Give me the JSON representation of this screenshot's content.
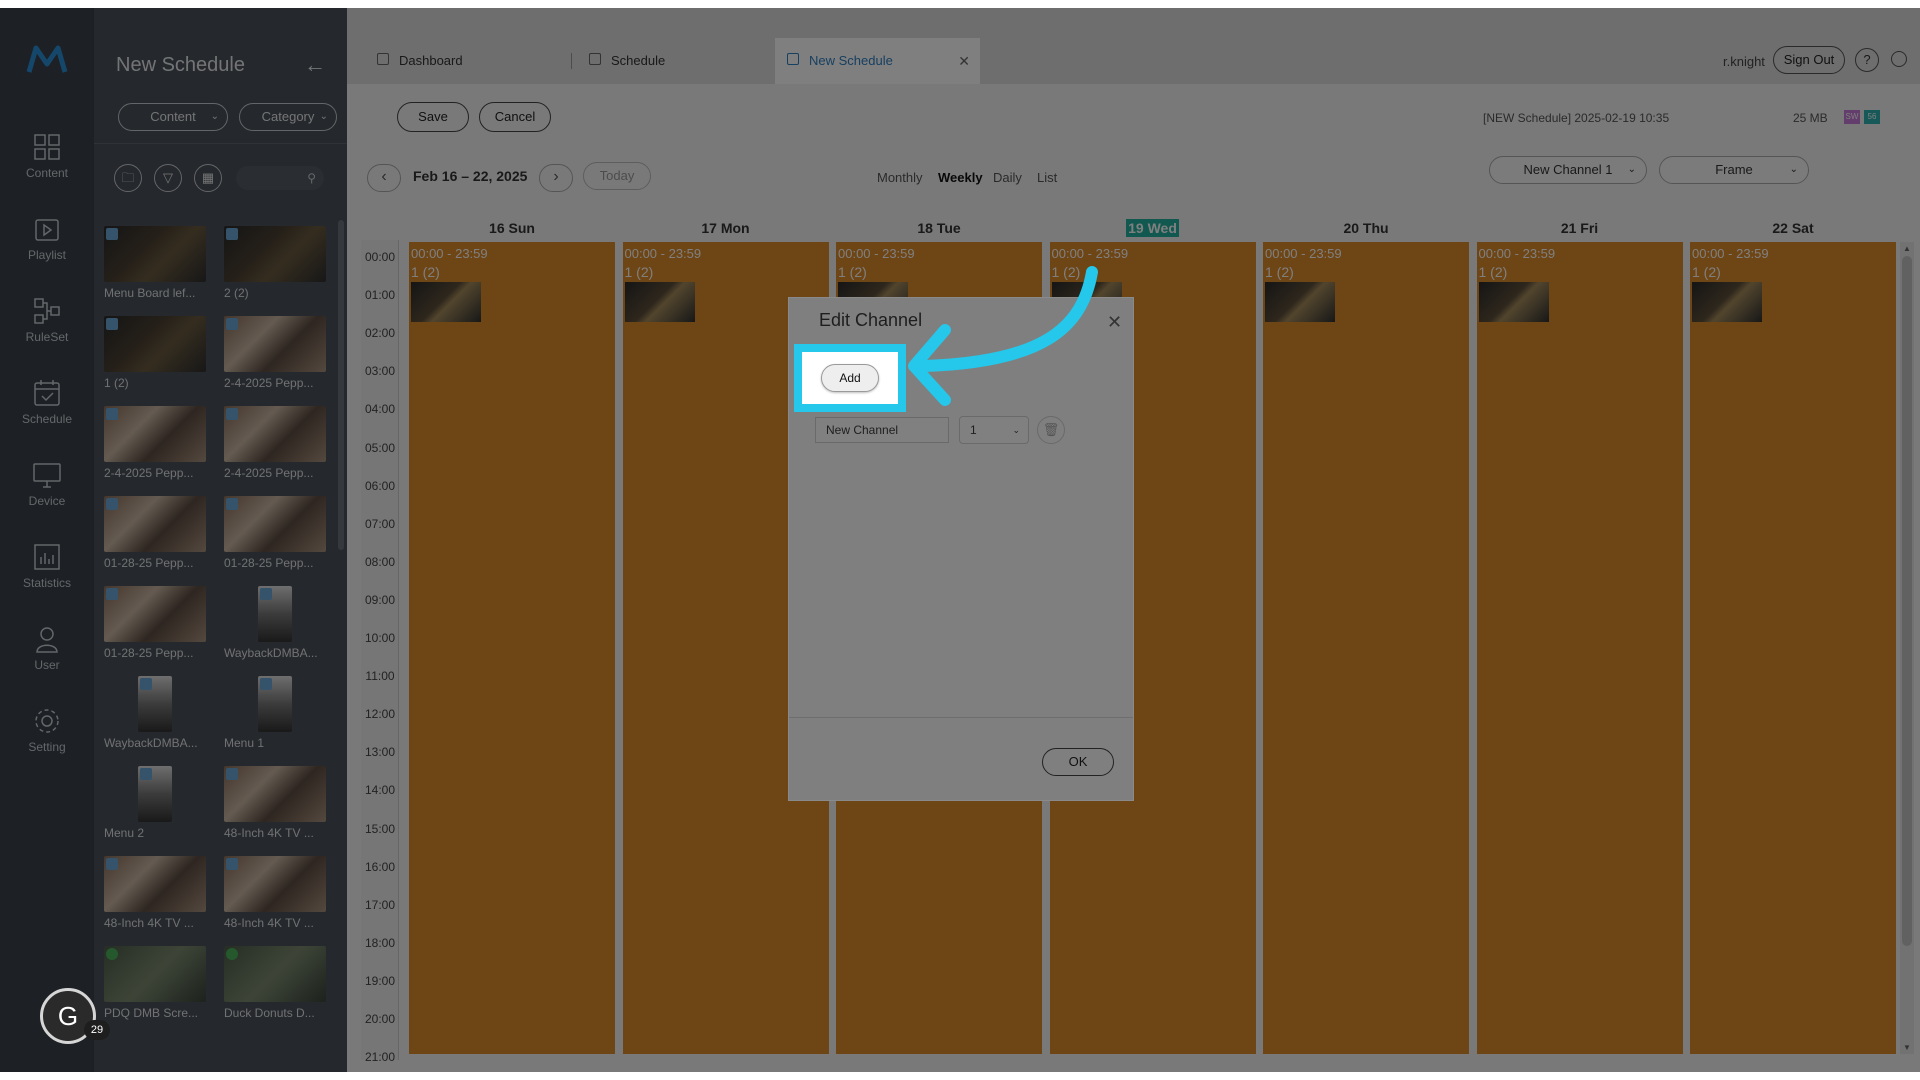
{
  "nav": {
    "items": [
      {
        "label": "Content",
        "icon": "grid-icon"
      },
      {
        "label": "Playlist",
        "icon": "playlist-icon"
      },
      {
        "label": "RuleSet",
        "icon": "ruleset-icon"
      },
      {
        "label": "Schedule",
        "icon": "calendar-icon"
      },
      {
        "label": "Device",
        "icon": "monitor-icon"
      },
      {
        "label": "Statistics",
        "icon": "bar-chart-icon"
      },
      {
        "label": "User",
        "icon": "user-icon"
      },
      {
        "label": "Setting",
        "icon": "gear-icon"
      }
    ]
  },
  "panel": {
    "title": "New Schedule",
    "filter_content": "Content",
    "filter_category": "Category",
    "thumbs": [
      {
        "caption": "Menu Board lef...",
        "kind": "menu"
      },
      {
        "caption": "2 (2)",
        "kind": "menu"
      },
      {
        "caption": "1 (2)",
        "kind": "menu"
      },
      {
        "caption": "2-4-2025 Pepp...",
        "kind": "food"
      },
      {
        "caption": "2-4-2025 Pepp...",
        "kind": "food"
      },
      {
        "caption": "2-4-2025 Pepp...",
        "kind": "food"
      },
      {
        "caption": "01-28-25 Pepp...",
        "kind": "food"
      },
      {
        "caption": "01-28-25 Pepp...",
        "kind": "food"
      },
      {
        "caption": "01-28-25 Pepp...",
        "kind": "food"
      },
      {
        "caption": "WaybackDMBA...",
        "kind": "tall"
      },
      {
        "caption": "WaybackDMBA...",
        "kind": "tall"
      },
      {
        "caption": "Menu 1",
        "kind": "tall"
      },
      {
        "caption": "Menu 2",
        "kind": "tall"
      },
      {
        "caption": "48-Inch 4K TV ...",
        "kind": "food"
      },
      {
        "caption": "48-Inch 4K TV ...",
        "kind": "food"
      },
      {
        "caption": "48-Inch 4K TV ...",
        "kind": "food"
      },
      {
        "caption": "PDQ DMB Scre...",
        "kind": "video"
      },
      {
        "caption": "Duck Donuts D...",
        "kind": "video"
      }
    ]
  },
  "tabs": [
    {
      "label": "Dashboard"
    },
    {
      "label": "Schedule"
    },
    {
      "label": "New Schedule"
    }
  ],
  "header": {
    "username": "r.knight",
    "sign_out": "Sign Out",
    "help": "?"
  },
  "toolbar": {
    "save": "Save",
    "cancel": "Cancel",
    "info": "[NEW Schedule] 2025-02-19 10:35",
    "size": "25 MB",
    "chip1": "SW",
    "chip1_color": "#c77bd8",
    "chip2": "56",
    "chip2_color": "#2fb2b0"
  },
  "calendar": {
    "range": "Feb 16 – 22, 2025",
    "today": "Today",
    "views": [
      "Monthly",
      "Weekly",
      "Daily",
      "List"
    ],
    "current_view": "Weekly",
    "channel_select": "New Channel 1",
    "frame_select": "Frame",
    "days": [
      "16 Sun",
      "17 Mon",
      "18 Tue",
      "19 Wed",
      "20 Thu",
      "21 Fri",
      "22 Sat"
    ],
    "today_index": 3,
    "hours": [
      "00:00",
      "01:00",
      "02:00",
      "03:00",
      "04:00",
      "05:00",
      "06:00",
      "07:00",
      "08:00",
      "09:00",
      "10:00",
      "11:00",
      "12:00",
      "13:00",
      "14:00",
      "15:00",
      "16:00",
      "17:00",
      "18:00",
      "19:00",
      "20:00",
      "21:00"
    ],
    "event_time": "00:00 - 23:59",
    "event_title": "1 (2)",
    "event_color": "#dd8a2a"
  },
  "dialog": {
    "title": "Edit Channel",
    "add": "Add",
    "channel_name": "New Channel",
    "channel_number": "1",
    "ok": "OK"
  },
  "highlight_color": "#25c7ea",
  "floating_badge": {
    "letter": "G",
    "count": "29"
  }
}
